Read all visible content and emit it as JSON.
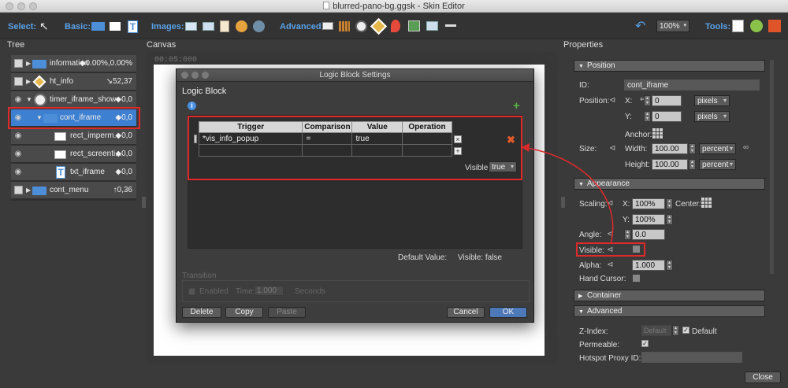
{
  "window": {
    "title": "blurred-pano-bg.ggsk - Skin Editor"
  },
  "toolbar": {
    "select_label": "Select:",
    "basic_label": "Basic:",
    "images_label": "Images:",
    "advanced_label": "Advanced:",
    "tools_label": "Tools:",
    "zoom": "100%",
    "accent_color": "#5aa2e8"
  },
  "panels": {
    "tree": "Tree",
    "canvas": "Canvas",
    "properties": "Properties"
  },
  "canvas": {
    "timecode": "00:05:000"
  },
  "tree": {
    "items": [
      {
        "name": "information",
        "value": "◆0.00%,0.00%"
      },
      {
        "name": "ht_info",
        "value": "↘52,37"
      },
      {
        "name": "timer_iframe_show",
        "value": "◆0,0"
      },
      {
        "name": "cont_iframe",
        "value": "◆0,0"
      },
      {
        "name": "rect_imperm...",
        "value": "◆0,0"
      },
      {
        "name": "rect_screenti...",
        "value": "◆0,0"
      },
      {
        "name": "txt_iframe",
        "value": "◆0,0"
      },
      {
        "name": "cont_menu",
        "value": "↑0,36"
      }
    ]
  },
  "dialog": {
    "title": "Logic Block Settings",
    "heading": "Logic Block",
    "columns": [
      "Trigger",
      "Comparison",
      "Value",
      "Operation"
    ],
    "rows": [
      {
        "trigger": "*vis_info_popup",
        "comparison": "=",
        "value": "true",
        "operation": ""
      }
    ],
    "visible_label": "Visible:",
    "visible_value": "true",
    "default_value_label": "Default Value:",
    "default_visible_label": "Visible:",
    "default_visible_value": "false",
    "transition_label": "Transition",
    "enabled_label": "Enabled",
    "time_label": "Time:",
    "time_value": "1.000",
    "seconds_label": "Seconds",
    "buttons": {
      "delete": "Delete",
      "copy": "Copy",
      "paste": "Paste",
      "cancel": "Cancel",
      "ok": "OK"
    }
  },
  "properties": {
    "position": {
      "title": "Position",
      "id_label": "ID:",
      "id_value": "cont_iframe",
      "position_label": "Position:",
      "x_label": "X:",
      "x_value": "0",
      "x_unit": "pixels",
      "y_label": "Y:",
      "y_value": "0",
      "y_unit": "pixels",
      "anchor_label": "Anchor:",
      "size_label": "Size:",
      "width_label": "Width:",
      "width_value": "100.00",
      "width_unit": "percent",
      "height_label": "Height:",
      "height_value": "100.00",
      "height_unit": "percent"
    },
    "appearance": {
      "title": "Appearance",
      "scaling_label": "Scaling:",
      "sx_label": "X:",
      "sx_value": "100%",
      "center_label": "Center:",
      "sy_label": "Y:",
      "sy_value": "100%",
      "angle_label": "Angle:",
      "angle_value": "0.0",
      "visible_label": "Visible:",
      "alpha_label": "Alpha:",
      "alpha_value": "1.000",
      "hand_cursor_label": "Hand Cursor:"
    },
    "container": {
      "title": "Container"
    },
    "advanced": {
      "title": "Advanced",
      "zindex_label": "Z-Index:",
      "zindex_placeholder": "Default",
      "default_label": "Default",
      "permeable_label": "Permeable:",
      "hotspot_label": "Hotspot Proxy ID:"
    }
  },
  "footer": {
    "close": "Close"
  },
  "highlight_color": "#e02a2a"
}
